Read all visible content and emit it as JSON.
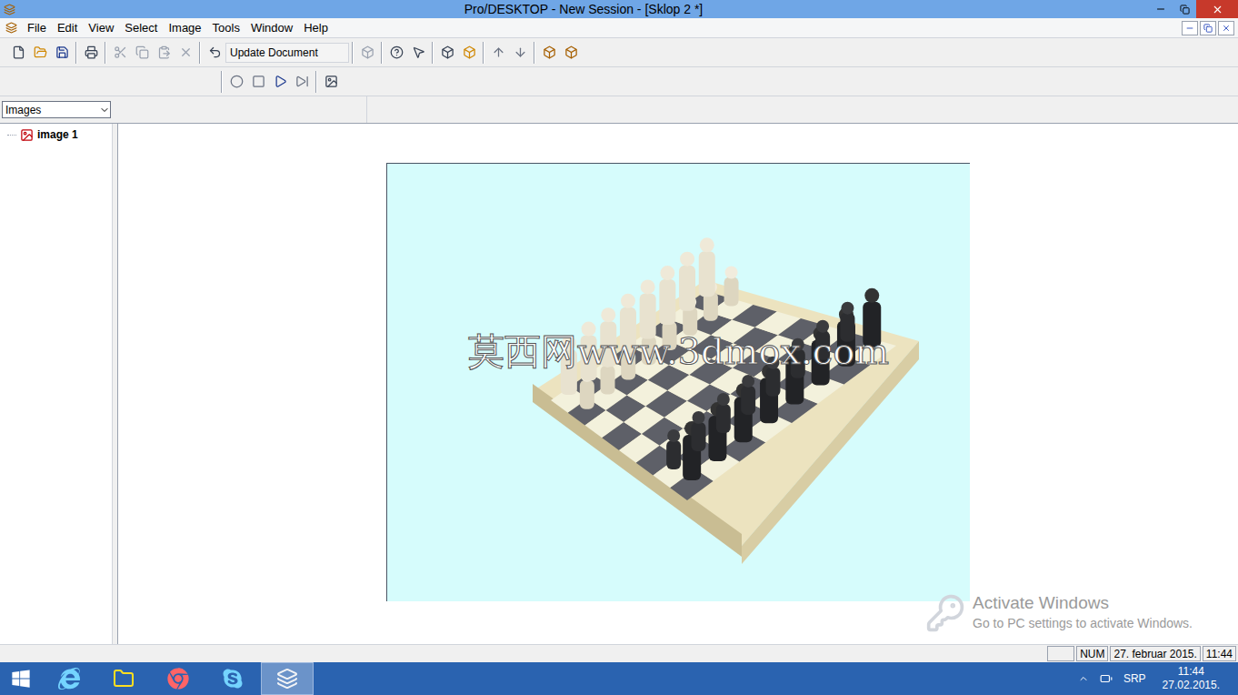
{
  "window": {
    "title": "Pro/DESKTOP - New Session - [Sklop 2 *]"
  },
  "menu": [
    "File",
    "Edit",
    "View",
    "Select",
    "Image",
    "Tools",
    "Window",
    "Help"
  ],
  "toolbar": {
    "field": "Update Document"
  },
  "dropdown": {
    "value": "Images"
  },
  "tree": [
    {
      "label": "image 1",
      "selected": false
    }
  ],
  "watermark": "莫西网www.3dmox.com",
  "activation": {
    "title": "Activate Windows",
    "subtitle": "Go to PC settings to activate Windows."
  },
  "status_bar": [
    "",
    "NUM",
    "27. februar 2015.",
    "11:44"
  ],
  "taskbar": {
    "language": "SRP",
    "time": "11:44",
    "date": "27.02.2015."
  }
}
